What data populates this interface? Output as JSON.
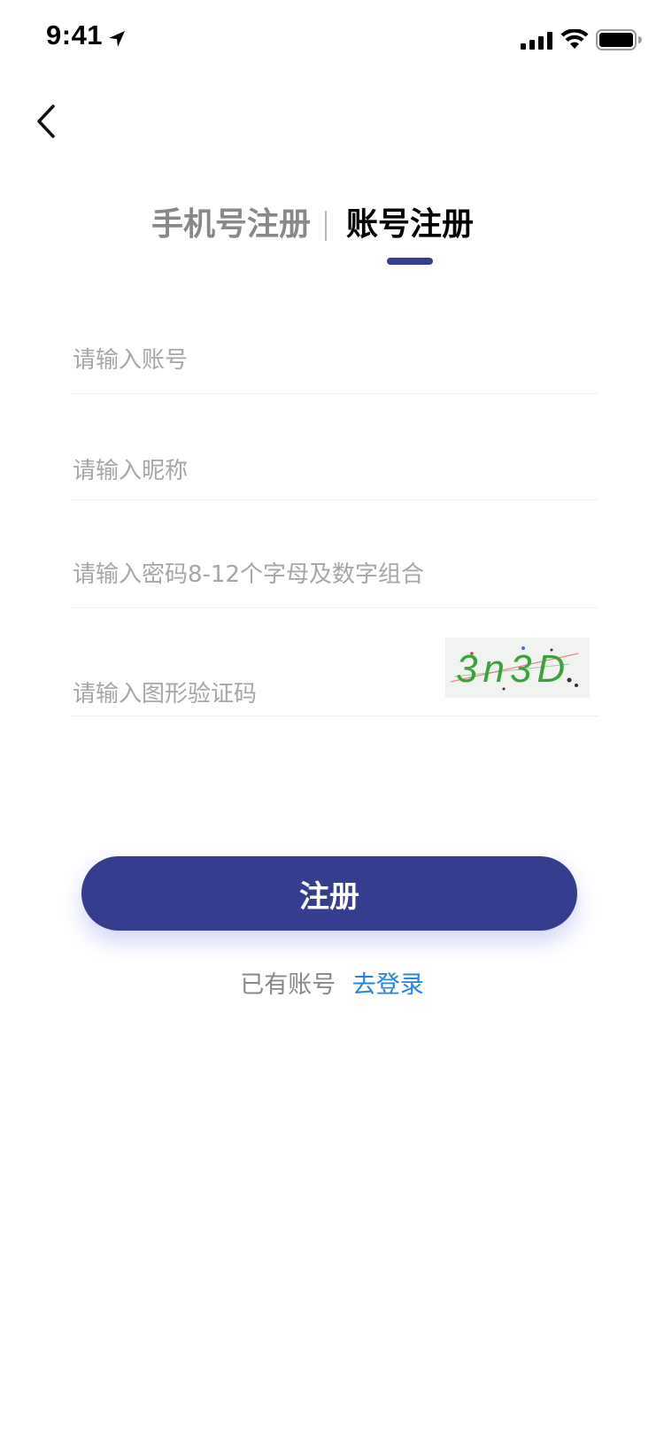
{
  "status_bar": {
    "time": "9:41",
    "icons": [
      "location-arrow-icon",
      "cellular-signal-icon",
      "wifi-icon",
      "battery-icon"
    ]
  },
  "nav": {
    "back_icon": "chevron-left-icon"
  },
  "tabs": [
    {
      "label": "手机号注册",
      "active": false
    },
    {
      "label": "账号注册",
      "active": true
    }
  ],
  "form": {
    "account_placeholder": "请输入账号",
    "account_value": "",
    "nickname_placeholder": "请输入昵称",
    "nickname_value": "",
    "password_placeholder": "请输入密码8-12个字母及数字组合",
    "password_value": "",
    "captcha_placeholder": "请输入图形验证码",
    "captcha_value": "",
    "captcha_image_text": "3n3D"
  },
  "actions": {
    "register_label": "注册",
    "login_prompt": "已有账号",
    "login_link": "去登录"
  },
  "colors": {
    "primary": "#353d8f",
    "link": "#2483e0",
    "tab_inactive": "#888888",
    "placeholder": "#a6a6a6",
    "captcha_text": "#3aa23a"
  }
}
